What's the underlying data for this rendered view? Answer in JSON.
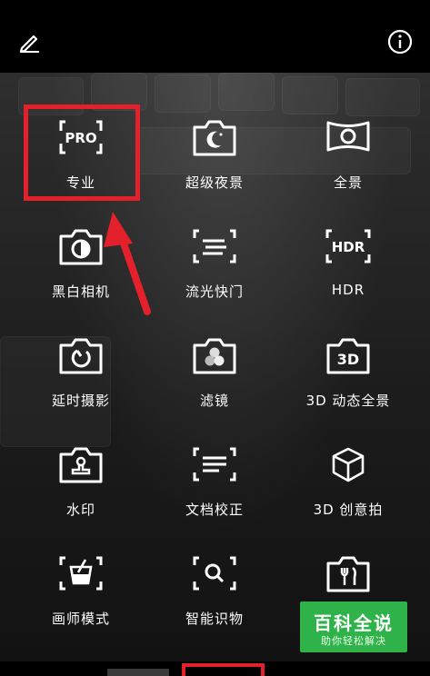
{
  "topbar": {
    "edit_icon": "pencil-icon",
    "info_icon": "info-icon"
  },
  "modes": [
    {
      "id": "pro",
      "label": "专业",
      "icon": "pro-icon",
      "row": 0,
      "col": 0
    },
    {
      "id": "super-night",
      "label": "超级夜景",
      "icon": "night-camera-icon",
      "row": 0,
      "col": 1
    },
    {
      "id": "panorama",
      "label": "全景",
      "icon": "panorama-icon",
      "row": 0,
      "col": 2
    },
    {
      "id": "mono",
      "label": "黑白相机",
      "icon": "bw-camera-icon",
      "row": 1,
      "col": 0
    },
    {
      "id": "light-painting",
      "label": "流光快门",
      "icon": "light-trail-icon",
      "row": 1,
      "col": 1
    },
    {
      "id": "hdr",
      "label": "HDR",
      "icon": "hdr-icon",
      "row": 1,
      "col": 2
    },
    {
      "id": "time-lapse",
      "label": "延时摄影",
      "icon": "timelapse-icon",
      "row": 2,
      "col": 0
    },
    {
      "id": "filter",
      "label": "滤镜",
      "icon": "filter-icon",
      "row": 2,
      "col": 1
    },
    {
      "id": "3d-panorama",
      "label": "3D 动态全景",
      "icon": "3d-icon",
      "row": 2,
      "col": 2
    },
    {
      "id": "watermark",
      "label": "水印",
      "icon": "stamp-icon",
      "row": 3,
      "col": 0
    },
    {
      "id": "document",
      "label": "文档校正",
      "icon": "document-icon",
      "row": 3,
      "col": 1
    },
    {
      "id": "3d-creative",
      "label": "3D 创意拍",
      "icon": "cube-icon",
      "row": 3,
      "col": 2
    },
    {
      "id": "artist",
      "label": "画师模式",
      "icon": "paint-icon",
      "row": 4,
      "col": 0
    },
    {
      "id": "smart-recognize",
      "label": "智能识物",
      "icon": "search-scan-icon",
      "row": 4,
      "col": 1
    },
    {
      "id": "food",
      "label": "",
      "icon": "food-icon",
      "row": 4,
      "col": 2
    }
  ],
  "watermark": {
    "title": "百科全说",
    "subtitle": "助你轻松解决"
  },
  "bottombar": {
    "tab_left": "…"
  },
  "colors": {
    "highlight": "#e3202b",
    "watermark_bg": "#2fb24a"
  }
}
